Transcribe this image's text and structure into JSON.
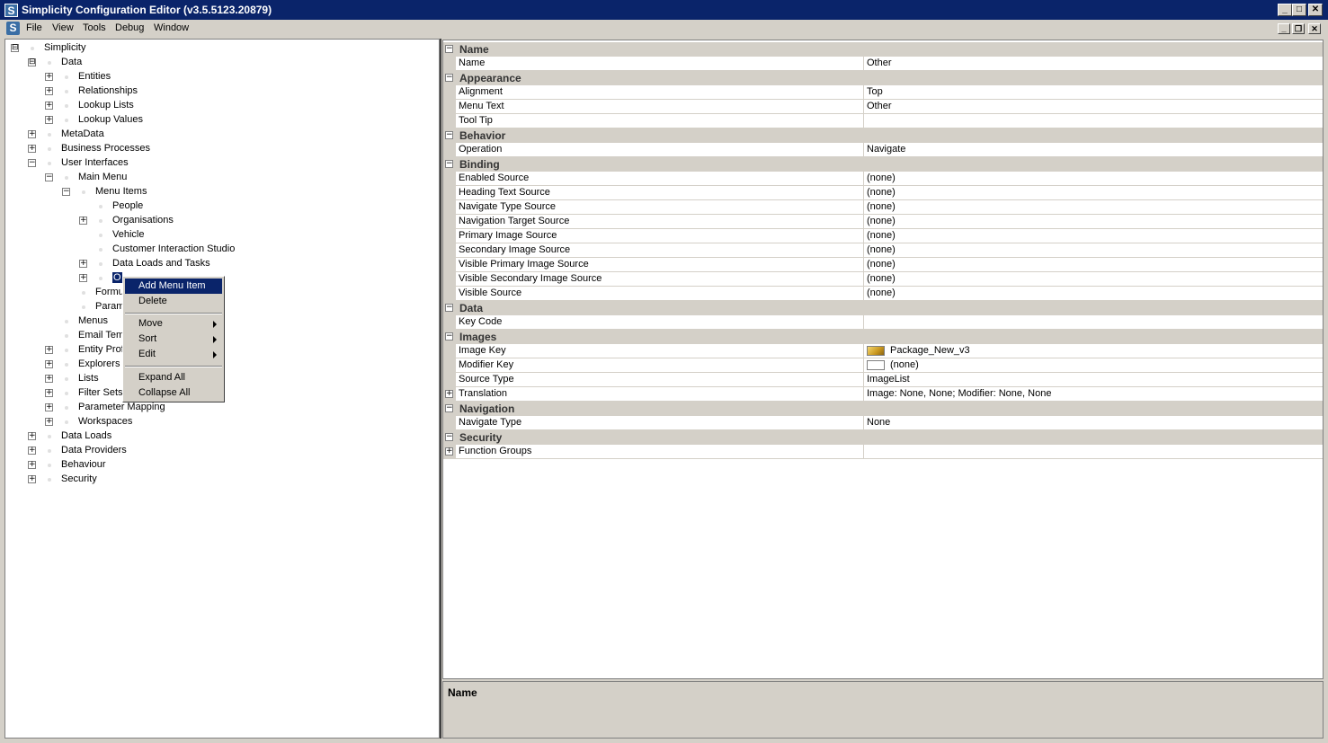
{
  "window": {
    "title": "Simplicity Configuration Editor (v3.5.5123.20879)",
    "app_icon": "S"
  },
  "menubar": {
    "items": [
      "File",
      "View",
      "Tools",
      "Debug",
      "Window"
    ]
  },
  "tree": {
    "nodes": [
      {
        "label": "Simplicity",
        "expander": "⊟"
      },
      {
        "label": "Data",
        "expander": "⊟"
      },
      {
        "label": "Entities",
        "expander": "+"
      },
      {
        "label": "Relationships",
        "expander": "+"
      },
      {
        "label": "Lookup Lists",
        "expander": "+"
      },
      {
        "label": "Lookup Values",
        "expander": "+"
      },
      {
        "label": "MetaData",
        "expander": "+"
      },
      {
        "label": "Business Processes",
        "expander": "+"
      },
      {
        "label": "User Interfaces",
        "expander": "−"
      },
      {
        "label": "Main Menu",
        "expander": "−"
      },
      {
        "label": "Menu Items",
        "expander": "−"
      },
      {
        "label": "People",
        "expander": ""
      },
      {
        "label": "Organisations",
        "expander": "+"
      },
      {
        "label": "Vehicle",
        "expander": ""
      },
      {
        "label": "Customer Interaction Studio",
        "expander": ""
      },
      {
        "label": "Data Loads and Tasks",
        "expander": "+"
      },
      {
        "label": "O",
        "expander": "+"
      },
      {
        "label": "Formu",
        "expander": ""
      },
      {
        "label": "Param",
        "expander": ""
      },
      {
        "label": "Menus",
        "expander": ""
      },
      {
        "label": "Email Tem",
        "expander": ""
      },
      {
        "label": "Entity Prof",
        "expander": "+"
      },
      {
        "label": "Explorers",
        "expander": "+"
      },
      {
        "label": "Lists",
        "expander": "+"
      },
      {
        "label": "Filter Sets",
        "expander": "+"
      },
      {
        "label": "Parameter Mapping",
        "expander": "+"
      },
      {
        "label": "Workspaces",
        "expander": "+"
      },
      {
        "label": "Data Loads",
        "expander": "+"
      },
      {
        "label": "Data Providers",
        "expander": "+"
      },
      {
        "label": "Behaviour",
        "expander": "+"
      },
      {
        "label": "Security",
        "expander": "+"
      }
    ]
  },
  "context_menu": {
    "items": [
      "Add Menu Item",
      "Delete",
      "Move",
      "Sort",
      "Edit",
      "Expand All",
      "Collapse All"
    ]
  },
  "property_grid": {
    "rows": [
      {
        "type": "cat",
        "label": "Name"
      },
      {
        "type": "prop",
        "name": "Name",
        "value": "Other"
      },
      {
        "type": "cat",
        "label": "Appearance"
      },
      {
        "type": "prop",
        "name": "Alignment",
        "value": "Top"
      },
      {
        "type": "prop",
        "name": "Menu Text",
        "value": "Other"
      },
      {
        "type": "prop",
        "name": "Tool Tip",
        "value": ""
      },
      {
        "type": "cat",
        "label": "Behavior"
      },
      {
        "type": "prop",
        "name": "Operation",
        "value": "Navigate"
      },
      {
        "type": "cat",
        "label": "Binding"
      },
      {
        "type": "prop",
        "name": "Enabled Source",
        "value": "(none)"
      },
      {
        "type": "prop",
        "name": "Heading Text Source",
        "value": "(none)"
      },
      {
        "type": "prop",
        "name": "Navigate Type Source",
        "value": "(none)"
      },
      {
        "type": "prop",
        "name": "Navigation Target Source",
        "value": "(none)"
      },
      {
        "type": "prop",
        "name": "Primary Image Source",
        "value": "(none)"
      },
      {
        "type": "prop",
        "name": "Secondary Image Source",
        "value": "(none)"
      },
      {
        "type": "prop",
        "name": "Visible Primary Image Source",
        "value": "(none)"
      },
      {
        "type": "prop",
        "name": "Visible Secondary Image Source",
        "value": "(none)"
      },
      {
        "type": "prop",
        "name": "Visible Source",
        "value": "(none)"
      },
      {
        "type": "cat",
        "label": "Data"
      },
      {
        "type": "prop",
        "name": "Key Code",
        "value": ""
      },
      {
        "type": "cat",
        "label": "Images"
      },
      {
        "type": "prop",
        "name": "Image Key",
        "value": "Package_New_v3",
        "swatch": "image"
      },
      {
        "type": "prop",
        "name": "Modifier Key",
        "value": "(none)",
        "swatch": "empty"
      },
      {
        "type": "prop",
        "name": "Source Type",
        "value": "ImageList"
      },
      {
        "type": "prop",
        "name": "Translation",
        "value": "Image: None, None; Modifier: None, None",
        "expandable": true
      },
      {
        "type": "cat",
        "label": "Navigation"
      },
      {
        "type": "prop",
        "name": "Navigate Type",
        "value": "None"
      },
      {
        "type": "cat",
        "label": "Security"
      },
      {
        "type": "prop",
        "name": "Function Groups",
        "value": "",
        "expandable": true
      }
    ]
  },
  "help_panel": {
    "title": "Name"
  }
}
